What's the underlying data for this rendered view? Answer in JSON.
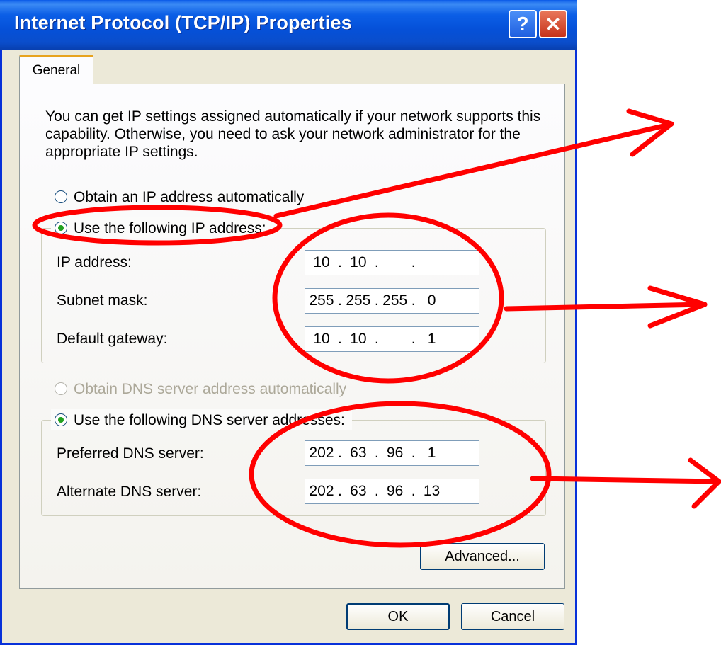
{
  "window": {
    "title": "Internet Protocol (TCP/IP) Properties",
    "help_glyph": "?",
    "close_glyph": "✕"
  },
  "tabs": [
    {
      "label": "General"
    }
  ],
  "intro_text": "You can get IP settings assigned automatically if your network supports this capability. Otherwise, you need to ask your network administrator for the appropriate IP settings.",
  "ip_section": {
    "auto_label": "Obtain an IP address automatically",
    "manual_label": "Use the following IP address:",
    "selected": "manual",
    "fields": [
      {
        "label": "IP address:",
        "octets": [
          "10",
          "10",
          "",
          ""
        ]
      },
      {
        "label": "Subnet mask:",
        "octets": [
          "255",
          "255",
          "255",
          "0"
        ]
      },
      {
        "label": "Default gateway:",
        "octets": [
          "10",
          "10",
          "",
          "1"
        ]
      }
    ]
  },
  "dns_section": {
    "auto_label": "Obtain DNS server address automatically",
    "auto_enabled": false,
    "manual_label": "Use the following DNS server addresses:",
    "selected": "manual",
    "fields": [
      {
        "label": "Preferred DNS server:",
        "octets": [
          "202",
          "63",
          "96",
          "1"
        ]
      },
      {
        "label": "Alternate DNS server:",
        "octets": [
          "202",
          "63",
          "96",
          "13"
        ]
      }
    ]
  },
  "buttons": {
    "advanced": "Advanced...",
    "ok": "OK",
    "cancel": "Cancel"
  },
  "colors": {
    "titlebar": "#0550d8",
    "annotation": "#ff0000",
    "dialog_bg": "#ece9d8"
  }
}
